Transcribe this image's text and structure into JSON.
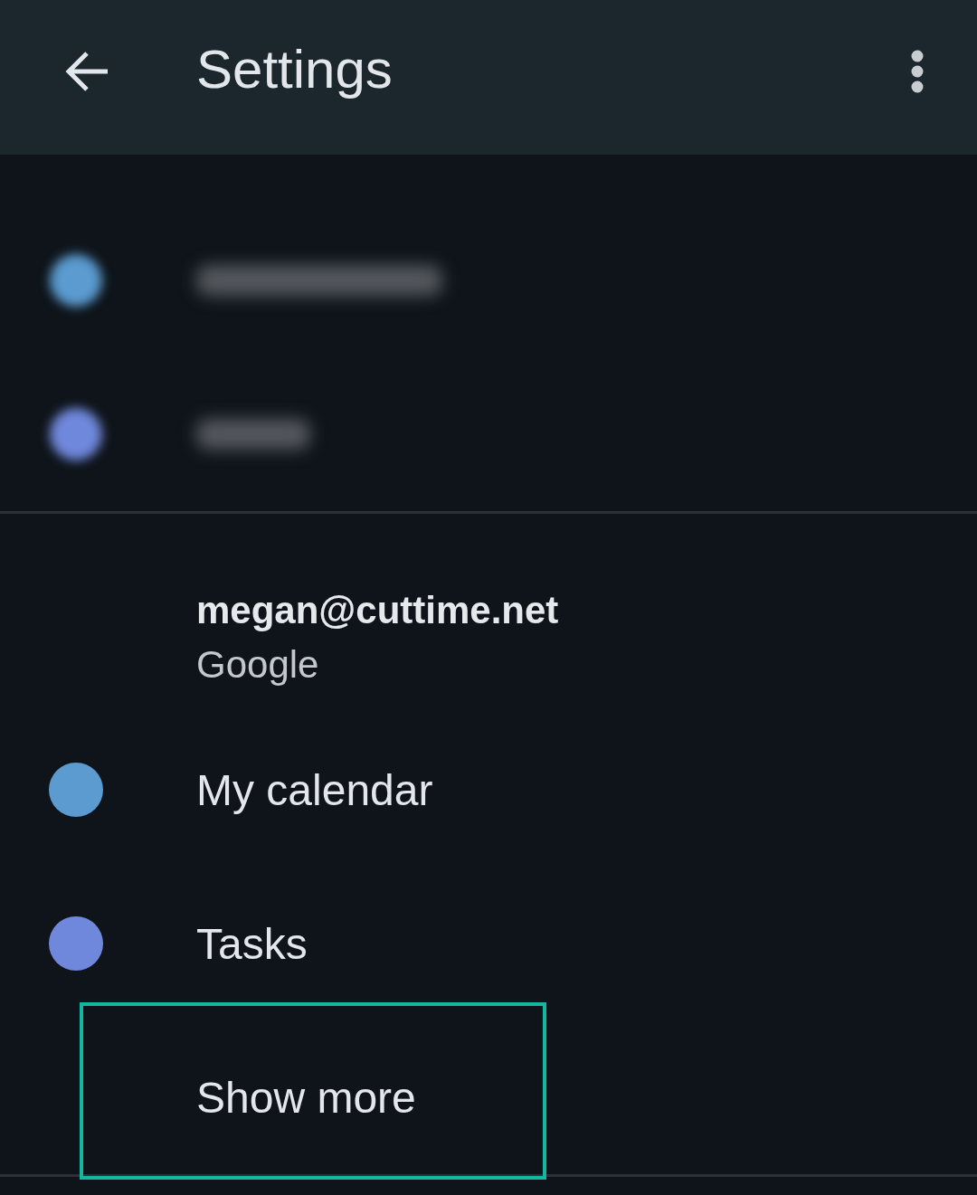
{
  "app_bar": {
    "title": "Settings"
  },
  "redacted_calendars": [
    {
      "color": "#5b9bd0"
    },
    {
      "color": "#7088dc"
    }
  ],
  "account": {
    "email": "megan@cuttime.net",
    "provider": "Google"
  },
  "calendars": [
    {
      "name": "My calendar",
      "color": "#5b9bd0"
    },
    {
      "name": "Tasks",
      "color": "#7088dc"
    }
  ],
  "show_more": {
    "label": "Show more",
    "highlighted": true
  }
}
